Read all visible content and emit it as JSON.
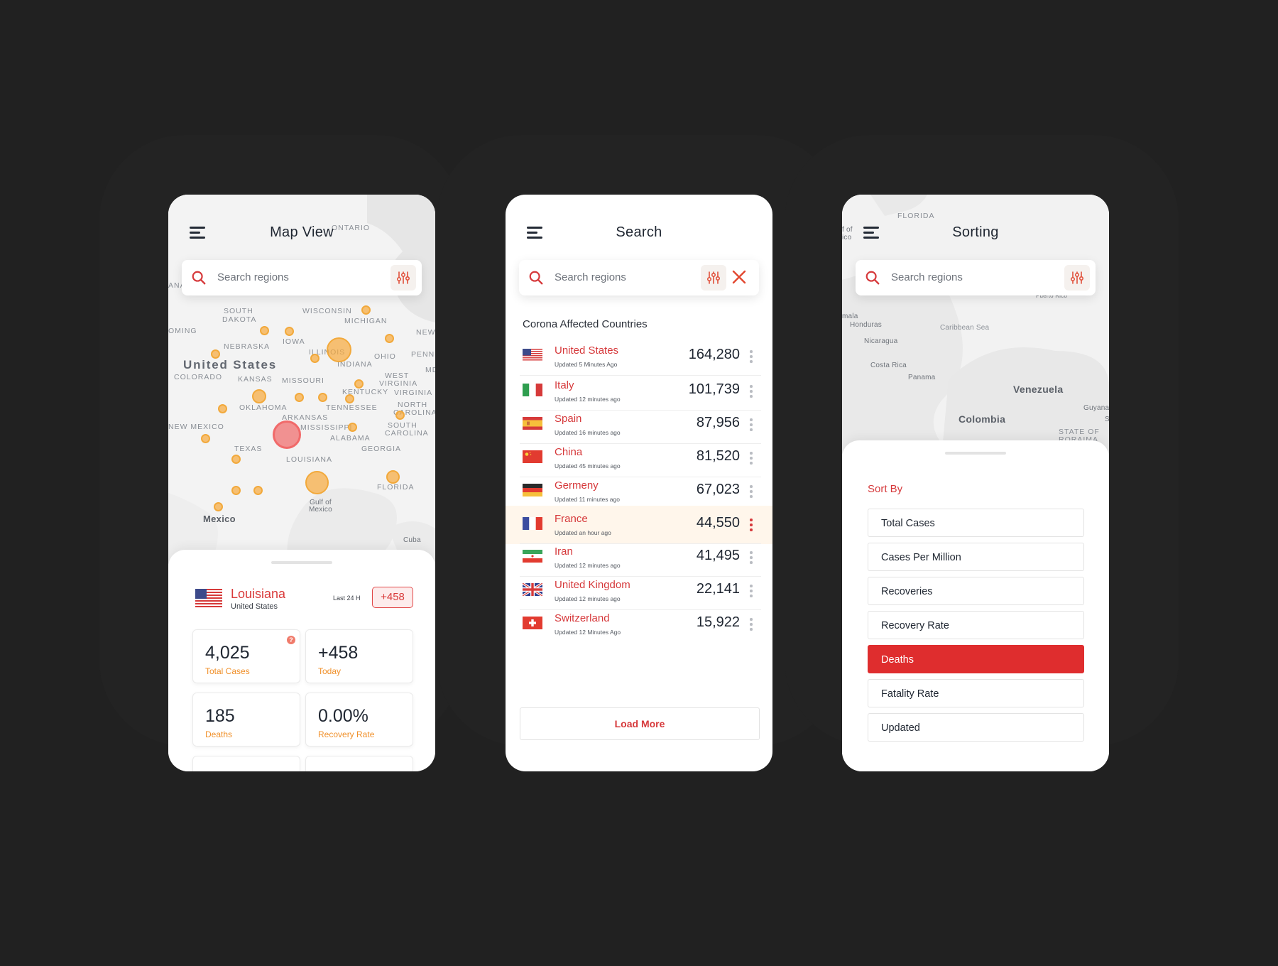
{
  "colors": {
    "accent": "#d6393b",
    "orange": "#f0902a",
    "marker": "#f7a83a",
    "active": "#df2d2e",
    "background": "#212121"
  },
  "map_view": {
    "title": "Map View",
    "search_placeholder": "Search regions",
    "labels": {
      "ontario": "ONTARIO",
      "wisconsin": "WISCONSIN",
      "michigan": "MICHIGAN",
      "south_dakota_1": "SOUTH",
      "south_dakota_2": "DAKOTA",
      "wyoming": "OMING",
      "iowa": "IOWA",
      "nebraska": "NEBRASKA",
      "new": "NEW",
      "penn": "PENN",
      "illinois": "ILLINOIS",
      "ohio": "OHIO",
      "indiana": "INDIANA",
      "md": "MD",
      "united_states": "United States",
      "colorado": "COLORADO",
      "kansas": "KANSAS",
      "missouri": "MISSOURI",
      "west_virginia_1": "WEST",
      "west_virginia_2": "VIRGINIA",
      "virginia": "VIRGINIA",
      "kentucky": "KENTUCKY",
      "oklahoma": "OKLAHOMA",
      "tennessee": "TENNESSEE",
      "north_carolina_1": "NORTH",
      "north_carolina_2": "CAROLINA",
      "arkansas": "ARKANSAS",
      "new_mexico": "NEW MEXICO",
      "mississippi": "MISSISSIPPI",
      "south_carolina_1": "SOUTH",
      "south_carolina_2": "CAROLINA",
      "alabama": "ALABAMA",
      "texas": "TEXAS",
      "georgia": "GEORGIA",
      "louisiana": "LOUISIANA",
      "florida": "FLORIDA",
      "gulf_1": "Gulf of",
      "gulf_2": "Mexico",
      "mexico": "Mexico",
      "cuba": "Cuba",
      "ana": "ANA"
    },
    "location": {
      "name": "Louisiana",
      "country": "United States",
      "last24_label": "Last 24 H",
      "today_badge": "+458"
    },
    "stats": [
      {
        "value": "4,025",
        "label": "Total Cases"
      },
      {
        "value": "+458",
        "label": "Today"
      },
      {
        "value": "185",
        "label": "Deaths"
      },
      {
        "value": "0.00%",
        "label": "Recovery Rate"
      }
    ],
    "info_icon": "?"
  },
  "search_view": {
    "title": "Search",
    "search_placeholder": "Search regions",
    "list_title": "Corona Affected Countries",
    "countries": [
      {
        "name": "United States",
        "updated": "Updated 5 Minutes Ago",
        "count": "164,280",
        "flag": "us"
      },
      {
        "name": "Italy",
        "updated": "Updated 12 minutes ago",
        "count": "101,739",
        "flag": "it"
      },
      {
        "name": "Spain",
        "updated": "Updated 16 minutes ago",
        "count": "87,956",
        "flag": "es"
      },
      {
        "name": "China",
        "updated": "Updated 45 minutes ago",
        "count": "81,520",
        "flag": "cn"
      },
      {
        "name": "Germeny",
        "updated": "Updated 11 minutes ago",
        "count": "67,023",
        "flag": "de"
      },
      {
        "name": "France",
        "updated": "Updated an hour ago",
        "count": "44,550",
        "flag": "fr"
      },
      {
        "name": "Iran",
        "updated": "Updated 12 minutes ago",
        "count": "41,495",
        "flag": "ir"
      },
      {
        "name": "United Kingdom",
        "updated": "Updated 12 minutes ago",
        "count": "22,141",
        "flag": "gb"
      },
      {
        "name": "Switzerland",
        "updated": "Updated 12 Minutes Ago",
        "count": "15,922",
        "flag": "ch"
      }
    ],
    "highlighted_index": 5,
    "load_more": "Load More"
  },
  "sort_view": {
    "title": "Sorting",
    "search_placeholder": "Search regions",
    "map_labels": {
      "florida": "FLORIDA",
      "of": "f of",
      "ico": "ico",
      "puerto_rico": "Puerto Rico",
      "mala": "mala",
      "honduras": "Honduras",
      "caribbean": "Caribbean Sea",
      "nicaragua": "Nicaragua",
      "costa_rica": "Costa Rica",
      "panama": "Panama",
      "venezuela": "Venezuela",
      "guyana": "Guyana",
      "s": "S",
      "colombia": "Colombia",
      "state_of_1": "STATE OF",
      "state_of_2": "RORAIMA"
    },
    "sort_title": "Sort By",
    "options": [
      "Total Cases",
      "Cases Per Million",
      "Recoveries",
      "Recovery Rate",
      "Deaths",
      "Fatality Rate",
      "Updated"
    ],
    "selected": "Deaths"
  }
}
